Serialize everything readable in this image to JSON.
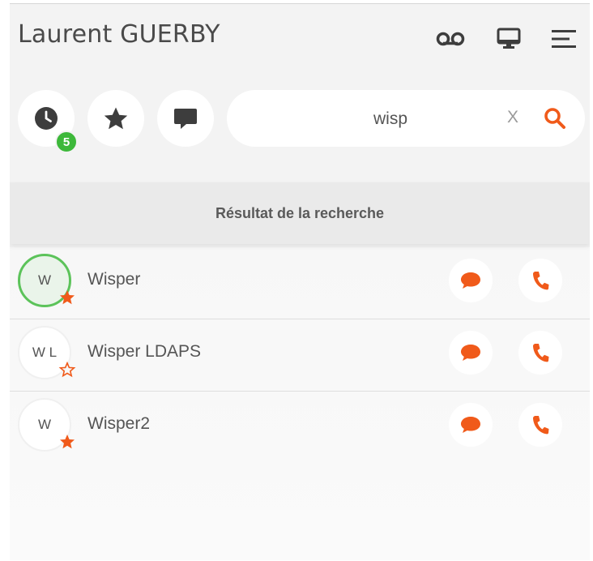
{
  "header": {
    "user_name": "Laurent GUERBY",
    "icons": [
      "voicemail-icon",
      "desktop-icon",
      "menu-icon"
    ]
  },
  "toolbar": {
    "history_badge": "5",
    "buttons": [
      "history-clock-icon",
      "favorites-star-icon",
      "messages-chat-icon"
    ]
  },
  "search": {
    "value": "wisp",
    "clear_label": "X"
  },
  "results": {
    "title": "Résultat de la recherche",
    "contacts": [
      {
        "initials": "W",
        "name": "Wisper",
        "favorite": true,
        "online": true
      },
      {
        "initials": "W L",
        "name": "Wisper LDAPS",
        "favorite": false,
        "online": false
      },
      {
        "initials": "W",
        "name": "Wisper2",
        "favorite": true,
        "online": false
      }
    ]
  },
  "colors": {
    "accent": "#f05a1a",
    "online": "#5cc35a",
    "badge": "#3db83a",
    "icon_dark": "#3d3d3d"
  }
}
